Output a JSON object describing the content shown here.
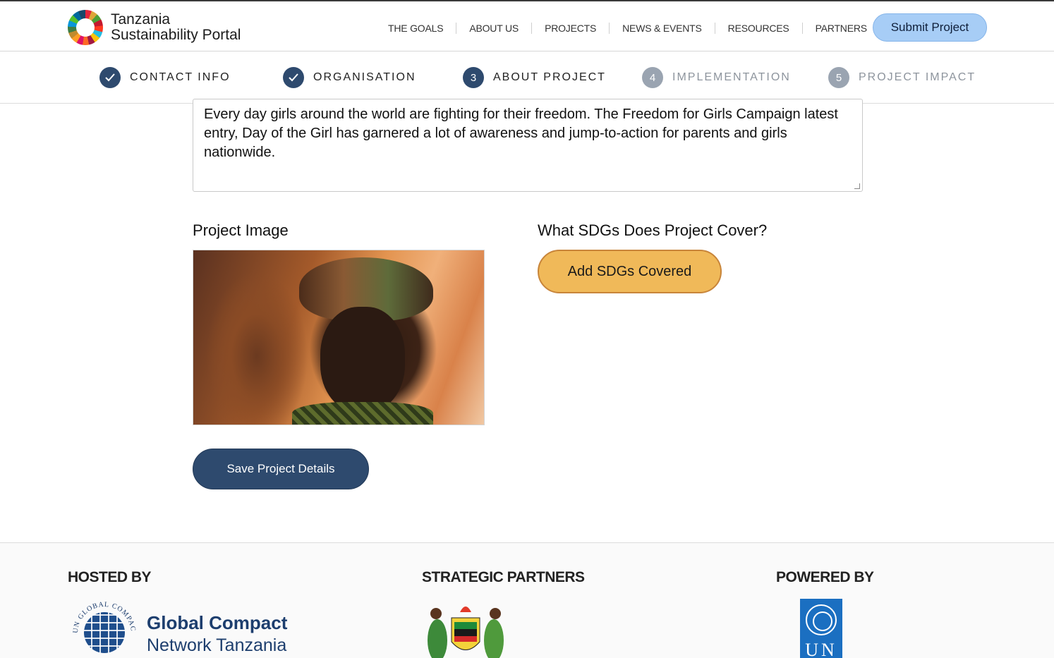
{
  "header": {
    "logo_line1": "Tanzania",
    "logo_line2": "Sustainability Portal",
    "nav": [
      "THE GOALS",
      "ABOUT US",
      "PROJECTS",
      "NEWS & EVENTS",
      "RESOURCES",
      "PARTNERS"
    ],
    "submit_label": "Submit Project"
  },
  "stepper": {
    "steps": [
      {
        "number": "1",
        "label": "CONTACT INFO",
        "state": "done"
      },
      {
        "number": "2",
        "label": "ORGANISATION",
        "state": "done"
      },
      {
        "number": "3",
        "label": "ABOUT PROJECT",
        "state": "active"
      },
      {
        "number": "4",
        "label": "IMPLEMENTATION",
        "state": "pending"
      },
      {
        "number": "5",
        "label": "PROJECT IMPACT",
        "state": "pending"
      }
    ]
  },
  "form": {
    "description": "Every day girls around the world are fighting for their freedom. The Freedom for Girls Campaign latest entry, Day of the Girl has garnered a lot of awareness and jump-to-action for parents and girls nationwide.",
    "image_label": "Project Image",
    "sdg_label": "What SDGs Does Project Cover?",
    "sdg_button": "Add SDGs Covered",
    "save_button": "Save Project Details"
  },
  "footer": {
    "hosted_by": "HOSTED BY",
    "strategic_partners": "STRATEGIC PARTNERS",
    "powered_by": "POWERED BY",
    "gc_name": "Global Compact",
    "gc_sub": "Network Tanzania",
    "gc_arc": "UN GLOBAL COMPACT",
    "un_text": "UN"
  },
  "colors": {
    "primary_navy": "#2e4a6e",
    "accent_orange": "#f0b959",
    "submit_blue": "#a7cdf6",
    "pending_gray": "#9aa4b1"
  },
  "icons": {
    "step_done": "check-icon"
  }
}
